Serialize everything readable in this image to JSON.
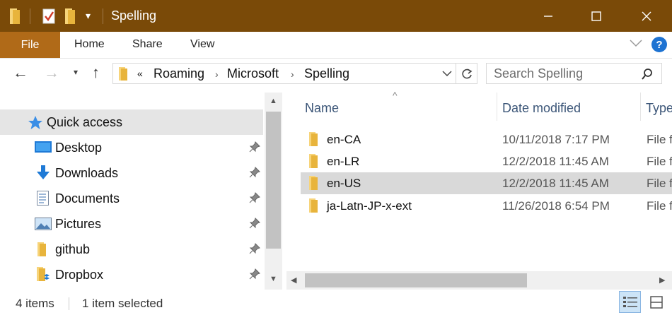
{
  "window": {
    "title": "Spelling"
  },
  "ribbon": {
    "tabs": [
      "File",
      "Home",
      "Share",
      "View"
    ]
  },
  "address": {
    "overflow": "«",
    "crumbs": [
      "Roaming",
      "Microsoft",
      "Spelling"
    ],
    "search_placeholder": "Search Spelling"
  },
  "nav": {
    "items": [
      {
        "label": "Quick access",
        "icon": "star-icon"
      },
      {
        "label": "Desktop",
        "icon": "desktop-icon"
      },
      {
        "label": "Downloads",
        "icon": "download-icon"
      },
      {
        "label": "Documents",
        "icon": "document-icon"
      },
      {
        "label": "Pictures",
        "icon": "picture-icon"
      },
      {
        "label": "github",
        "icon": "folder-icon"
      },
      {
        "label": "Dropbox",
        "icon": "dropbox-icon"
      }
    ]
  },
  "columns": {
    "name": "Name",
    "date": "Date modified",
    "type": "Type"
  },
  "files": [
    {
      "name": "en-CA",
      "date": "10/11/2018 7:17 PM",
      "type": "File folder"
    },
    {
      "name": "en-LR",
      "date": "12/2/2018 11:45 AM",
      "type": "File folder"
    },
    {
      "name": "en-US",
      "date": "12/2/2018 11:45 AM",
      "type": "File folder"
    },
    {
      "name": "ja-Latn-JP-x-ext",
      "date": "11/26/2018 6:54 PM",
      "type": "File folder"
    }
  ],
  "status": {
    "count": "4 items",
    "selected": "1 item selected"
  },
  "colors": {
    "titlebar": "#7a4a08",
    "file_tab": "#b06a18",
    "selected": "#d9d9d9",
    "folder": "#f2c14e"
  }
}
